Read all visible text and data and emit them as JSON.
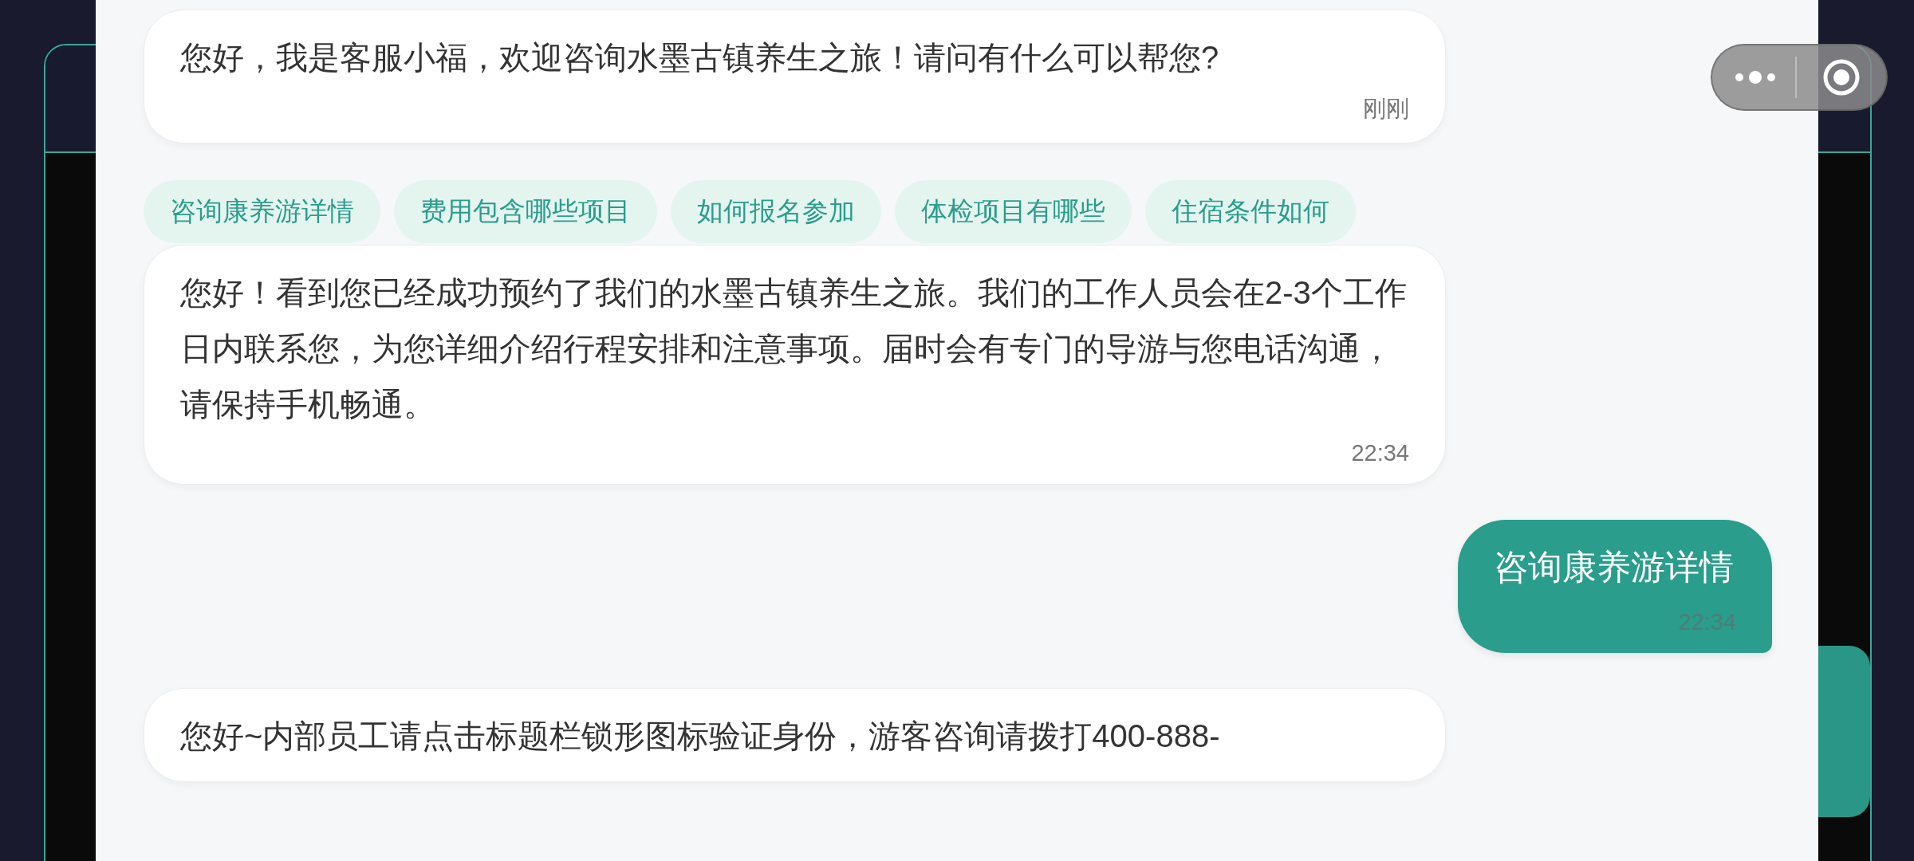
{
  "messages": [
    {
      "kind": "bot",
      "text": "您好，我是客服小福，欢迎咨询水墨古镇养生之旅！请问有什么可以帮您?",
      "time": "刚刚"
    },
    {
      "kind": "suggestions",
      "chips": [
        "咨询康养游详情",
        "费用包含哪些项目",
        "如何报名参加",
        "体检项目有哪些",
        "住宿条件如何"
      ]
    },
    {
      "kind": "bot",
      "text": "您好！看到您已经成功预约了我们的水墨古镇养生之旅。我们的工作人员会在2-3个工作日内联系您，为您详细介绍行程安排和注意事项。届时会有专门的导游与您电话沟通，请保持手机畅通。",
      "time": "22:34"
    },
    {
      "kind": "user",
      "text": "咨询康养游详情",
      "time": "22:34"
    },
    {
      "kind": "bot",
      "text": "您好~内部员工请点击标题栏锁形图标验证身份，游客咨询请拨打400-888-"
    }
  ]
}
